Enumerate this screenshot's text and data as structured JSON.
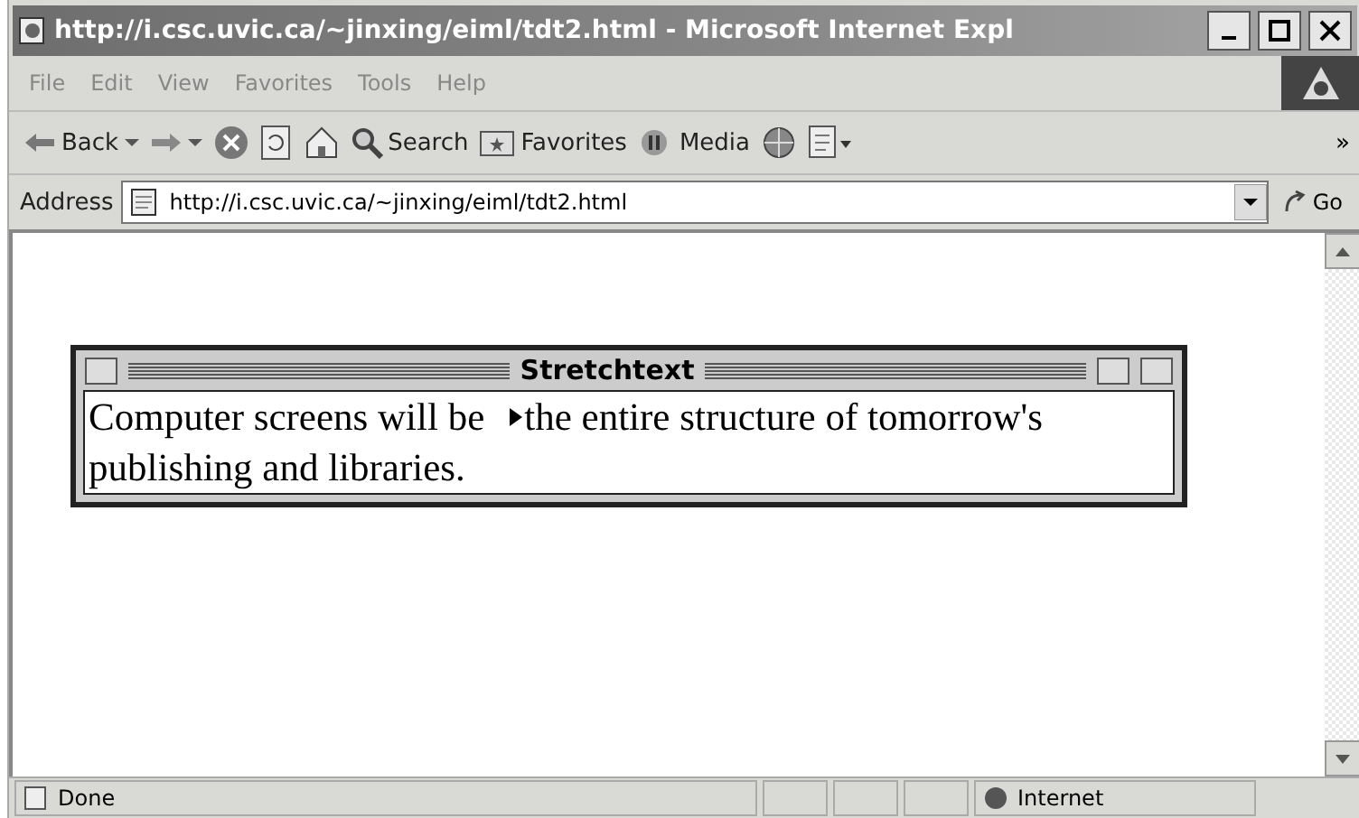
{
  "window": {
    "title": "http://i.csc.uvic.ca/~jinxing/eiml/tdt2.html - Microsoft Internet Expl"
  },
  "menu": [
    "File",
    "Edit",
    "View",
    "Favorites",
    "Tools",
    "Help"
  ],
  "toolbar": [
    {
      "kind": "back",
      "label": "Back"
    },
    {
      "kind": "forward"
    },
    {
      "kind": "stop"
    },
    {
      "kind": "refresh"
    },
    {
      "kind": "home"
    },
    {
      "kind": "search",
      "label": "Search"
    },
    {
      "kind": "favorites",
      "label": "Favorites"
    },
    {
      "kind": "media",
      "label": "Media"
    },
    {
      "kind": "history"
    },
    {
      "kind": "edit"
    }
  ],
  "toolbar_more": "»",
  "address": {
    "label": "Address",
    "value": "http://i.csc.uvic.ca/~jinxing/eiml/tdt2.html",
    "go": "Go"
  },
  "stretch_window": {
    "title": "Stretchtext",
    "text_before": "Computer screens will be",
    "text_after_lines": [
      "the entire structure of tomorrow's",
      "publishing and libraries."
    ],
    "expanded": false
  },
  "status_bar": {
    "text": "Done",
    "zone": "Internet"
  }
}
